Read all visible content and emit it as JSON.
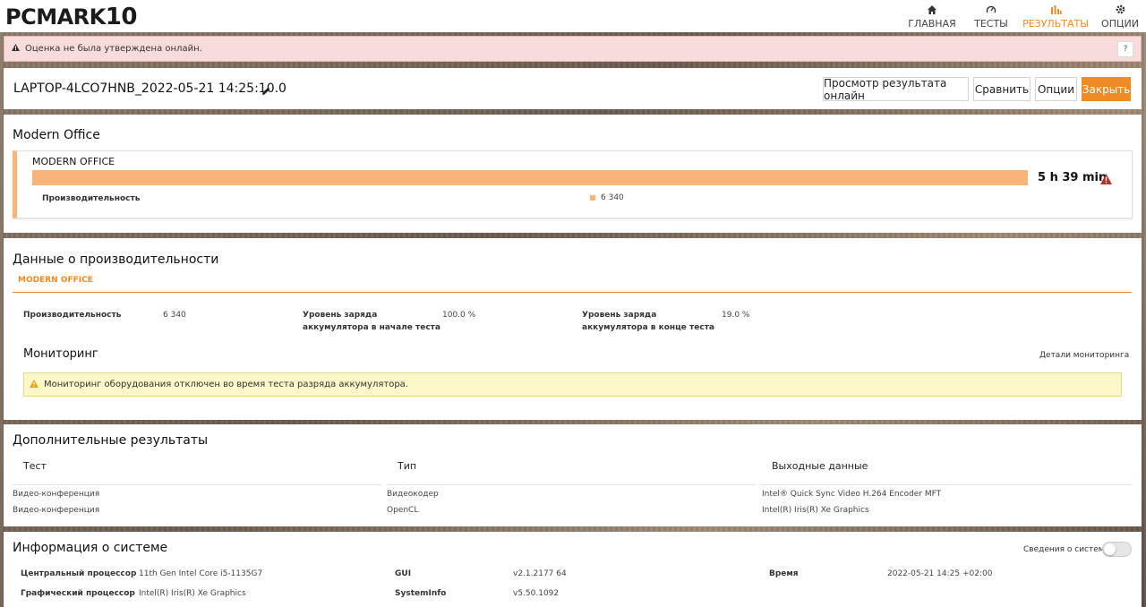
{
  "app": {
    "logo_main": "PCMARK",
    "logo_num": "10"
  },
  "nav": [
    {
      "label": "ГЛАВНАЯ",
      "icon": "home-icon"
    },
    {
      "label": "ТЕСТЫ",
      "icon": "gauge-icon"
    },
    {
      "label": "РЕЗУЛЬТАТЫ",
      "icon": "bar-chart-icon"
    },
    {
      "label": "ОПЦИИ",
      "icon": "gear-icon"
    }
  ],
  "colors": {
    "accent": "#f08a24",
    "bar": "#f9b47a",
    "alert_bg": "#f8dcdc",
    "warn_bg": "#fbf7c8"
  },
  "alert": {
    "text": "Оценка не была утверждена онлайн.",
    "help": "?"
  },
  "result": {
    "title": "LAPTOP-4LCO7HNB_2022-05-21 14:25:10.0",
    "buttons": {
      "view_online": "Просмотр результата онлайн",
      "compare": "Сравнить",
      "options": "Опции",
      "close": "Закрыть"
    }
  },
  "modern_office": {
    "heading": "Modern Office",
    "card_title": "MODERN OFFICE",
    "score": "5 h 39 min",
    "sub_label": "Производительность",
    "sub_value": "6 340"
  },
  "performance": {
    "heading": "Данные о производительности",
    "tab": "MODERN OFFICE",
    "items": [
      {
        "label": "Производительность",
        "value": "6 340"
      },
      {
        "label_1": "Уровень заряда",
        "label_2": "аккумулятора в начале теста",
        "value": "100.0 %"
      },
      {
        "label_1": "Уровень заряда",
        "label_2": "аккумулятора в конце теста",
        "value": "19.0 %"
      }
    ],
    "monitoring_heading": "Мониторинг",
    "monitoring_link": "Детали мониторинга",
    "monitoring_warning": "Мониторинг оборудования отключен во время теста разряда аккумулятора."
  },
  "extra": {
    "heading": "Дополнительные результаты",
    "columns": [
      "Тест",
      "Тип",
      "Выходные данные"
    ],
    "rows": [
      [
        "Видео-конференция",
        "Видеокодер",
        "Intel® Quick Sync Video H.264 Encoder MFT"
      ],
      [
        "Видео-конференция",
        "OpenCL",
        "Intel(R) Iris(R) Xe Graphics"
      ]
    ]
  },
  "system": {
    "heading": "Информация о системе",
    "toggle_label": "Сведения о системе",
    "rows": [
      {
        "label": "Центральный процессор",
        "value": "11th Gen Intel Core i5-1135G7"
      },
      {
        "label": "Графический процессор",
        "value": "Intel(R) Iris(R) Xe Graphics"
      },
      {
        "label": "GUI",
        "value": "v2.1.2177 64"
      },
      {
        "label": "SystemInfo",
        "value": "v5.50.1092"
      },
      {
        "label": "Время",
        "value": "2022-05-21 14:25 +02:00"
      }
    ]
  }
}
